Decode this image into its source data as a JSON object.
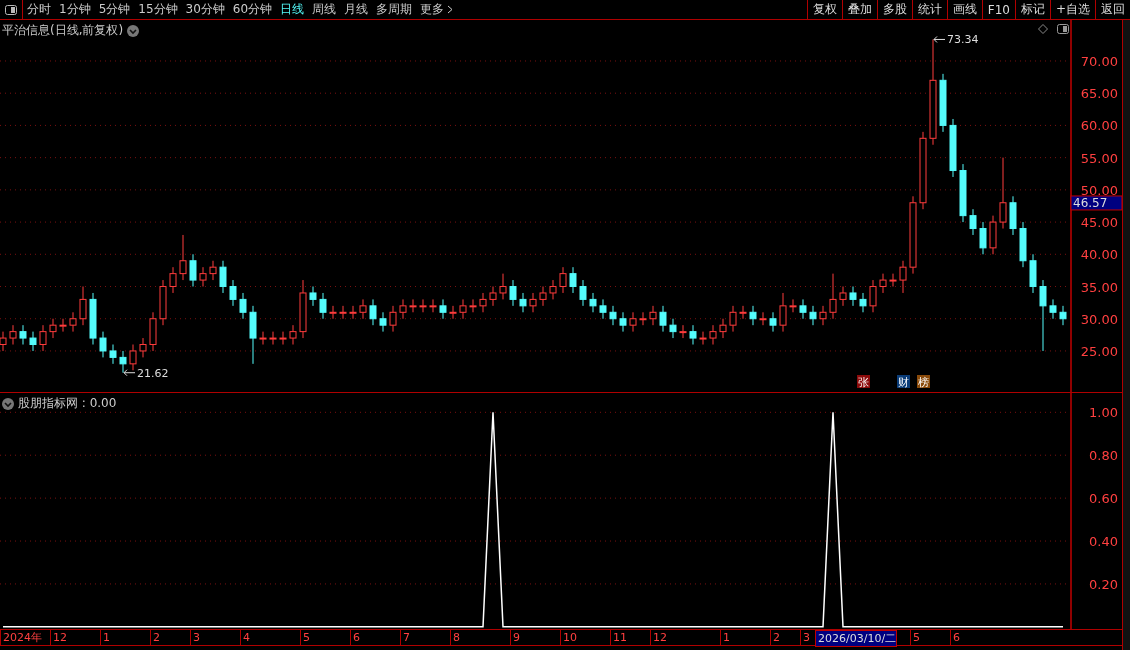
{
  "toolbar": {
    "periods": [
      {
        "label": "分时",
        "selected": false
      },
      {
        "label": "1分钟",
        "selected": false
      },
      {
        "label": "5分钟",
        "selected": false
      },
      {
        "label": "15分钟",
        "selected": false
      },
      {
        "label": "30分钟",
        "selected": false
      },
      {
        "label": "60分钟",
        "selected": false
      },
      {
        "label": "日线",
        "selected": true
      },
      {
        "label": "周线",
        "selected": false
      },
      {
        "label": "月线",
        "selected": false
      },
      {
        "label": "多周期",
        "selected": false
      }
    ],
    "more": "更多",
    "buttons": [
      "复权",
      "叠加",
      "多股",
      "统计",
      "画线",
      "F10",
      "标记",
      "+自选",
      "返回"
    ]
  },
  "price_panel": {
    "title": "平治信息(日线,前复权)",
    "chart_data": {
      "type": "candlestick",
      "grid": true,
      "ohlc": [
        [
          26,
          28,
          25,
          27
        ],
        [
          27,
          29,
          26,
          28
        ],
        [
          28,
          29,
          26,
          27
        ],
        [
          27,
          28,
          25,
          26
        ],
        [
          26,
          29,
          25,
          28
        ],
        [
          28,
          30,
          27,
          29
        ],
        [
          29,
          30,
          28,
          29
        ],
        [
          29,
          31,
          28,
          30
        ],
        [
          30,
          35,
          29,
          33
        ],
        [
          33,
          34,
          26,
          27
        ],
        [
          27,
          28,
          24,
          25
        ],
        [
          25,
          26,
          23,
          24
        ],
        [
          24,
          25,
          21.62,
          23
        ],
        [
          23,
          26,
          22,
          25
        ],
        [
          25,
          27,
          24,
          26
        ],
        [
          26,
          31,
          25,
          30
        ],
        [
          30,
          36,
          29,
          35
        ],
        [
          35,
          38,
          34,
          37
        ],
        [
          37,
          43,
          36,
          39
        ],
        [
          39,
          40,
          35,
          36
        ],
        [
          36,
          38,
          35,
          37
        ],
        [
          37,
          39,
          36,
          38
        ],
        [
          38,
          39,
          34,
          35
        ],
        [
          35,
          36,
          32,
          33
        ],
        [
          33,
          34,
          30,
          31
        ],
        [
          31,
          32,
          23,
          27
        ],
        [
          27,
          28,
          26,
          27
        ],
        [
          27,
          28,
          26,
          27
        ],
        [
          27,
          28,
          26,
          27
        ],
        [
          27,
          29,
          26,
          28
        ],
        [
          28,
          36,
          27,
          34
        ],
        [
          34,
          35,
          32,
          33
        ],
        [
          33,
          34,
          30,
          31
        ],
        [
          31,
          32,
          30,
          31
        ],
        [
          31,
          32,
          30,
          31
        ],
        [
          31,
          32,
          30,
          31
        ],
        [
          31,
          33,
          30,
          32
        ],
        [
          32,
          33,
          29,
          30
        ],
        [
          30,
          31,
          28,
          29
        ],
        [
          29,
          32,
          28,
          31
        ],
        [
          31,
          33,
          30,
          32
        ],
        [
          32,
          33,
          31,
          32
        ],
        [
          32,
          33,
          31,
          32
        ],
        [
          32,
          33,
          31,
          32
        ],
        [
          32,
          33,
          30,
          31
        ],
        [
          31,
          32,
          30,
          31
        ],
        [
          31,
          33,
          30,
          32
        ],
        [
          32,
          33,
          31,
          32
        ],
        [
          32,
          34,
          31,
          33
        ],
        [
          33,
          35,
          32,
          34
        ],
        [
          34,
          37,
          33,
          35
        ],
        [
          35,
          36,
          32,
          33
        ],
        [
          33,
          34,
          31,
          32
        ],
        [
          32,
          34,
          31,
          33
        ],
        [
          33,
          35,
          32,
          34
        ],
        [
          34,
          36,
          33,
          35
        ],
        [
          35,
          38,
          34,
          37
        ],
        [
          37,
          38,
          34,
          35
        ],
        [
          35,
          36,
          32,
          33
        ],
        [
          33,
          34,
          31,
          32
        ],
        [
          32,
          33,
          30,
          31
        ],
        [
          31,
          32,
          29,
          30
        ],
        [
          30,
          31,
          28,
          29
        ],
        [
          29,
          31,
          28,
          30
        ],
        [
          30,
          31,
          29,
          30
        ],
        [
          30,
          32,
          29,
          31
        ],
        [
          31,
          32,
          28,
          29
        ],
        [
          29,
          30,
          27,
          28
        ],
        [
          28,
          29,
          27,
          28
        ],
        [
          28,
          29,
          26,
          27
        ],
        [
          27,
          28,
          26,
          27
        ],
        [
          27,
          29,
          26,
          28
        ],
        [
          28,
          30,
          27,
          29
        ],
        [
          29,
          32,
          28,
          31
        ],
        [
          31,
          32,
          30,
          31
        ],
        [
          31,
          32,
          29,
          30
        ],
        [
          30,
          31,
          29,
          30
        ],
        [
          30,
          31,
          28,
          29
        ],
        [
          29,
          34,
          28,
          32
        ],
        [
          32,
          33,
          31,
          32
        ],
        [
          32,
          33,
          30,
          31
        ],
        [
          31,
          32,
          29,
          30
        ],
        [
          30,
          32,
          29,
          31
        ],
        [
          31,
          37,
          30,
          33
        ],
        [
          33,
          35,
          32,
          34
        ],
        [
          34,
          35,
          32,
          33
        ],
        [
          33,
          34,
          31,
          32
        ],
        [
          32,
          36,
          31,
          35
        ],
        [
          35,
          37,
          34,
          36
        ],
        [
          36,
          37,
          35,
          36
        ],
        [
          36,
          39,
          34,
          38
        ],
        [
          38,
          49,
          37,
          48
        ],
        [
          48,
          59,
          47,
          58
        ],
        [
          58,
          73.34,
          57,
          67
        ],
        [
          67,
          68,
          59,
          60
        ],
        [
          60,
          61,
          52,
          53
        ],
        [
          53,
          54,
          45,
          46
        ],
        [
          46,
          47,
          43,
          44
        ],
        [
          44,
          45,
          40,
          41
        ],
        [
          41,
          46,
          40,
          45
        ],
        [
          45,
          55,
          44,
          48
        ],
        [
          48,
          49,
          43,
          44
        ],
        [
          44,
          45,
          38,
          39
        ],
        [
          39,
          40,
          34,
          35
        ],
        [
          35,
          36,
          25,
          32
        ],
        [
          32,
          33,
          30,
          31
        ],
        [
          31,
          32,
          29,
          30
        ]
      ],
      "ylim": [
        18.63,
        76.36
      ],
      "yticks": [
        {
          "value": 70,
          "label": "70.00"
        },
        {
          "value": 65,
          "label": "65.00"
        },
        {
          "value": 60,
          "label": "60.00"
        },
        {
          "value": 55,
          "label": "55.00"
        },
        {
          "value": 50,
          "label": "50.00"
        },
        {
          "value": 45,
          "label": "45.00"
        },
        {
          "value": 40,
          "label": "40.00"
        },
        {
          "value": 35,
          "label": "35.00"
        },
        {
          "value": 30,
          "label": "30.00"
        },
        {
          "value": 25,
          "label": "25.00"
        }
      ]
    },
    "high_label": "73.34",
    "low_label": "21.62",
    "current_price": "46.57",
    "badges": [
      {
        "label": "张",
        "color": "#8b0a0a"
      },
      {
        "label": "财",
        "color": "#0a3c78"
      },
      {
        "label": "榜",
        "color": "#8a4a0a"
      }
    ]
  },
  "indicator_panel": {
    "title": "股朋指标网 : 0.00",
    "chart_data": {
      "type": "line",
      "grid": true,
      "values": [
        0,
        0,
        0,
        0,
        0,
        0,
        0,
        0,
        0,
        0,
        0,
        0,
        0,
        0,
        0,
        0,
        0,
        0,
        0,
        0,
        0,
        0,
        0,
        0,
        0,
        0,
        0,
        0,
        0,
        0,
        0,
        0,
        0,
        0,
        0,
        0,
        0,
        0,
        0,
        0,
        0,
        0,
        0,
        0,
        0,
        0,
        0,
        0,
        0,
        1,
        0,
        0,
        0,
        0,
        0,
        0,
        0,
        0,
        0,
        0,
        0,
        0,
        0,
        0,
        0,
        0,
        0,
        0,
        0,
        0,
        0,
        0,
        0,
        0,
        0,
        0,
        0,
        0,
        0,
        0,
        0,
        0,
        0,
        1,
        0,
        0,
        0,
        0,
        0,
        0,
        0,
        0,
        0,
        0,
        0,
        0,
        0,
        0,
        0,
        0,
        0,
        0,
        0,
        0,
        0,
        0,
        0
      ],
      "ylim": [
        -0.01,
        1.09
      ],
      "yticks": [
        {
          "value": 1,
          "label": "1.00"
        },
        {
          "value": 0.8,
          "label": "0.80"
        },
        {
          "value": 0.6,
          "label": "0.60"
        },
        {
          "value": 0.4,
          "label": "0.40"
        },
        {
          "value": 0.2,
          "label": "0.20"
        }
      ]
    }
  },
  "date_axis": [
    {
      "label": "2024年",
      "selected": false
    },
    {
      "label": "12",
      "selected": false
    },
    {
      "label": "1",
      "selected": false
    },
    {
      "label": "2",
      "selected": false
    },
    {
      "label": "3",
      "selected": false
    },
    {
      "label": "4",
      "selected": false
    },
    {
      "label": "5",
      "selected": false
    },
    {
      "label": "6",
      "selected": false
    },
    {
      "label": "7",
      "selected": false
    },
    {
      "label": "8",
      "selected": false
    },
    {
      "label": "9",
      "selected": false
    },
    {
      "label": "10",
      "selected": false
    },
    {
      "label": "11",
      "selected": false
    },
    {
      "label": "12",
      "selected": false
    },
    {
      "label": "1",
      "selected": false
    },
    {
      "label": "2",
      "selected": false
    },
    {
      "label": "3",
      "selected": false
    },
    {
      "label": "2026/03/10/二",
      "selected": true
    },
    {
      "label": "5",
      "selected": false
    },
    {
      "label": "6",
      "selected": false
    }
  ]
}
